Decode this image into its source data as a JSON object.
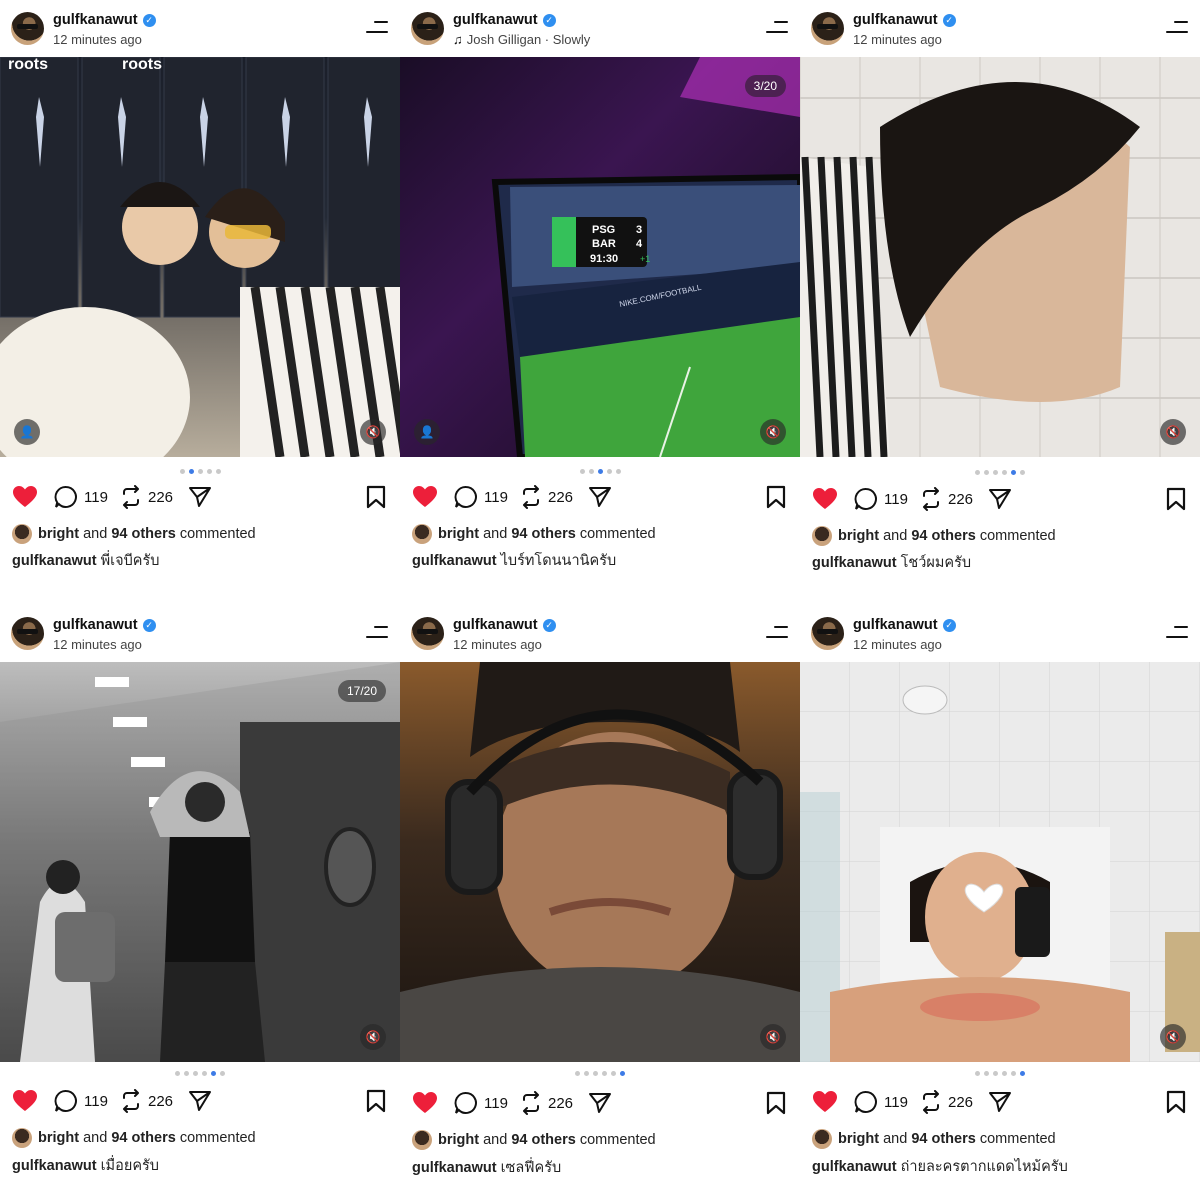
{
  "colors": {
    "accent": "#3d7be6",
    "heart": "#ed1f3a",
    "verified": "#2f8ff0"
  },
  "posts": [
    {
      "username": "gulfkanawut",
      "subline": "12 minutes ago",
      "music": false,
      "counter": "",
      "has_tag": true,
      "likes_icon": "heart-filled-icon",
      "comments": "119",
      "reposts": "226",
      "commented_name": "bright",
      "commented_and": "and",
      "commented_count": "94 others",
      "commented_suffix": "commented",
      "caption_user": "gulfkanawut",
      "caption_text": "พี่เจบีครับ",
      "dots": 5,
      "active_dot": 1
    },
    {
      "username": "gulfkanawut",
      "subline": "Josh Gilligan · Slowly",
      "music": true,
      "counter": "3/20",
      "has_tag": true,
      "likes_icon": "heart-filled-icon",
      "comments": "119",
      "reposts": "226",
      "commented_name": "bright",
      "commented_and": "and",
      "commented_count": "94 others",
      "commented_suffix": "commented",
      "caption_user": "gulfkanawut",
      "caption_text": "ไบร์ทโดนนานิครับ",
      "dots": 5,
      "active_dot": 2
    },
    {
      "username": "gulfkanawut",
      "subline": "12 minutes ago",
      "music": false,
      "counter": "",
      "has_tag": false,
      "likes_icon": "heart-filled-icon",
      "comments": "119",
      "reposts": "226",
      "commented_name": "bright",
      "commented_and": "and",
      "commented_count": "94 others",
      "commented_suffix": "commented",
      "caption_user": "gulfkanawut",
      "caption_text": "โชว์ผมครับ",
      "dots": 6,
      "active_dot": 4
    },
    {
      "username": "gulfkanawut",
      "subline": "12 minutes ago",
      "music": false,
      "counter": "17/20",
      "has_tag": false,
      "likes_icon": "heart-filled-icon",
      "comments": "119",
      "reposts": "226",
      "commented_name": "bright",
      "commented_and": "and",
      "commented_count": "94 others",
      "commented_suffix": "commented",
      "caption_user": "gulfkanawut",
      "caption_text": "เมื่อยครับ",
      "dots": 6,
      "active_dot": 4
    },
    {
      "username": "gulfkanawut",
      "subline": "12 minutes ago",
      "music": false,
      "counter": "",
      "has_tag": false,
      "likes_icon": "heart-filled-icon",
      "comments": "119",
      "reposts": "226",
      "commented_name": "bright",
      "commented_and": "and",
      "commented_count": "94 others",
      "commented_suffix": "commented",
      "caption_user": "gulfkanawut",
      "caption_text": "เซลฟี่ครับ",
      "dots": 6,
      "active_dot": 5
    },
    {
      "username": "gulfkanawut",
      "subline": "12 minutes ago",
      "music": false,
      "counter": "",
      "has_tag": false,
      "likes_icon": "heart-filled-icon",
      "comments": "119",
      "reposts": "226",
      "commented_name": "bright",
      "commented_and": "and",
      "commented_count": "94 others",
      "commented_suffix": "commented",
      "caption_user": "gulfkanawut",
      "caption_text": "ถ่ายละครตากแดดไหม้ครับ",
      "dots": 6,
      "active_dot": 5
    }
  ],
  "scoreboard": {
    "team_a": "PSG",
    "score_a": "3",
    "team_b": "BAR",
    "score_b": "4",
    "clock": "91:30",
    "extra": "+1"
  },
  "ad_text": "NIKE.COM/FOOTBALL",
  "poster_text": "roots"
}
